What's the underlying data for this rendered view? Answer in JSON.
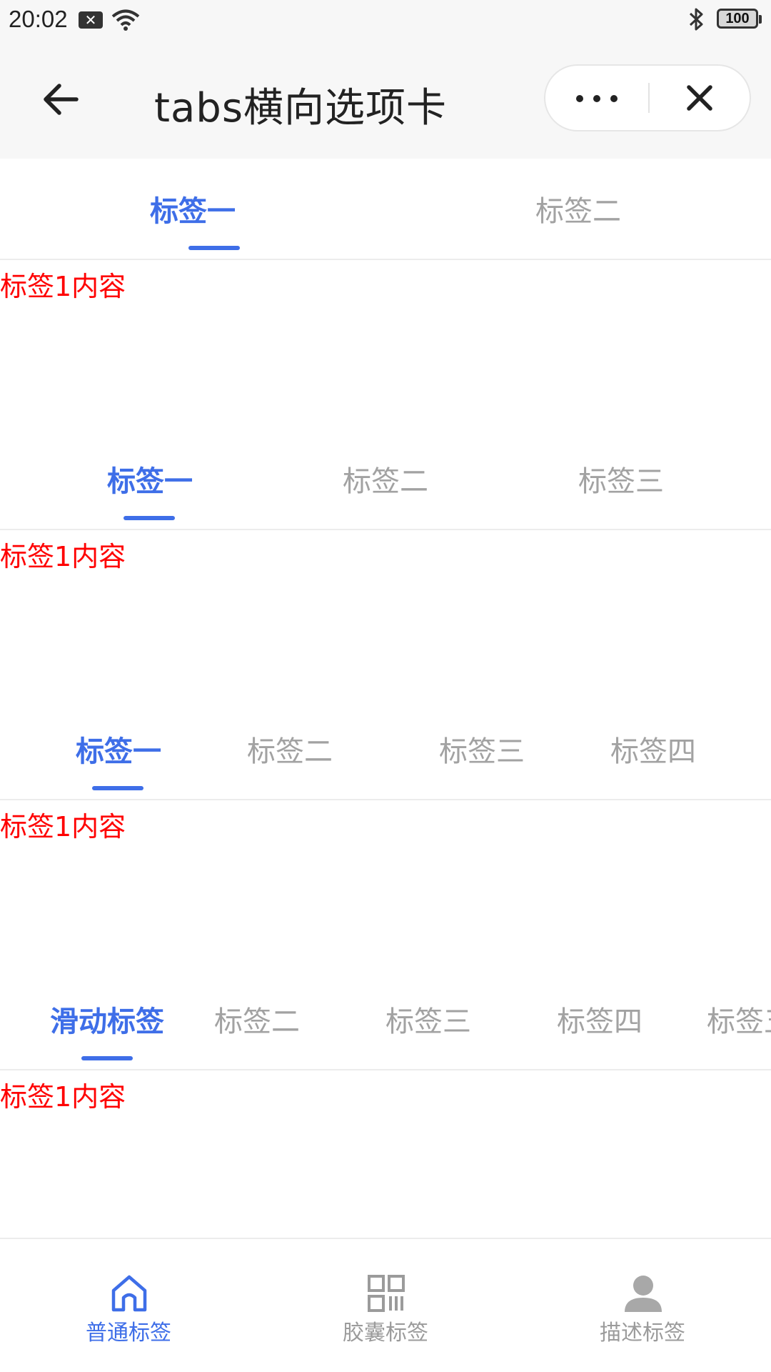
{
  "status_bar": {
    "time": "20:02",
    "notification_icon": "message-x-icon",
    "wifi_icon": "wifi-icon",
    "bluetooth_icon": "bluetooth-icon",
    "battery": "100"
  },
  "nav": {
    "title": "tabs横向选项卡",
    "back_icon": "arrow-left-icon",
    "more_icon": "more-dots-icon",
    "close_icon": "close-icon"
  },
  "accent_color": "#3e6ee8",
  "content_color": "#ff0000",
  "tab_groups": [
    {
      "tabs": [
        "标签一",
        "标签二"
      ],
      "active": 0,
      "content": "标签1内容"
    },
    {
      "tabs": [
        "标签一",
        "标签二",
        "标签三"
      ],
      "active": 0,
      "content": "标签1内容"
    },
    {
      "tabs": [
        "标签一",
        "标签二",
        "标签三",
        "标签四"
      ],
      "active": 0,
      "content": "标签1内容"
    },
    {
      "tabs": [
        "滑动标签",
        "标签二",
        "标签三",
        "标签四",
        "标签五"
      ],
      "active": 0,
      "content": "标签1内容"
    }
  ],
  "tabbar": {
    "items": [
      {
        "label": "普通标签",
        "icon": "home-icon",
        "active": true
      },
      {
        "label": "胶囊标签",
        "icon": "grid-icon",
        "active": false
      },
      {
        "label": "描述标签",
        "icon": "user-icon",
        "active": false
      }
    ]
  }
}
